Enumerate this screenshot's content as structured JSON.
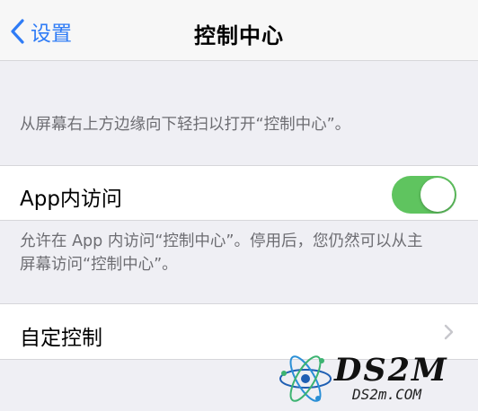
{
  "nav": {
    "back_label": "设置",
    "title": "控制中心"
  },
  "footer_lock_screen": "从屏幕右上方边缘向下轻扫以打开“控制中心”。",
  "in_app_access": {
    "label": "App内访问",
    "enabled": true,
    "toggle_color": "#5fc45f",
    "footnote_line1": "允许在 App 内访问“控制中心”。停用后，您仍然可以从主",
    "footnote_line2": "屏幕访问“控制中心”。"
  },
  "customize": {
    "label": "自定控制"
  },
  "watermark": {
    "brand": "DS2M",
    "url": "DS2m.COM"
  },
  "colors": {
    "accent": "#2f7cf6",
    "background": "#efeff4",
    "footnote": "#6d6d72"
  }
}
